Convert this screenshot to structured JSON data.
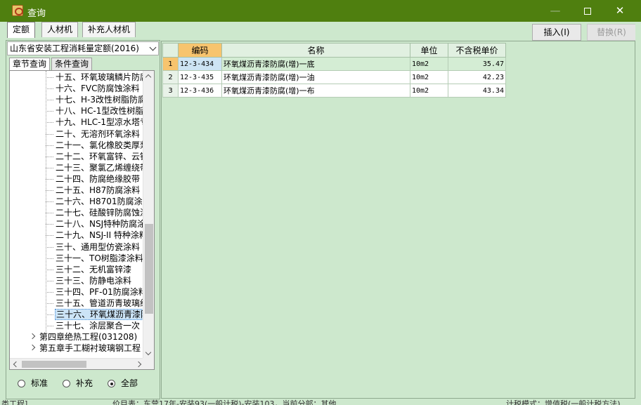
{
  "window": {
    "title": "查询"
  },
  "tabs": [
    "定额",
    "人材机",
    "补充人材机"
  ],
  "buttons": {
    "insert": "插入(I)",
    "replace": "替换(R)"
  },
  "left": {
    "dropdown": "山东省安装工程消耗量定额(2016)",
    "subtabs": [
      "章节查询",
      "条件查询"
    ],
    "tree": [
      {
        "label": "十五、环氧玻璃鳞片防腐",
        "type": "leaf"
      },
      {
        "label": "十六、FVC防腐蚀涂料",
        "type": "leaf"
      },
      {
        "label": "十七、H-3改性树脂防腐",
        "type": "leaf"
      },
      {
        "label": "十八、HC-1型改性树脂防",
        "type": "leaf"
      },
      {
        "label": "十九、HLC-1型凉水塔专",
        "type": "leaf"
      },
      {
        "label": "二十、无溶剂环氧涂料",
        "type": "leaf"
      },
      {
        "label": "二十一、氯化橡胶类厚浆",
        "type": "leaf"
      },
      {
        "label": "二十二、环氧富锌、云铁",
        "type": "leaf"
      },
      {
        "label": "二十三、聚氯乙烯缠绕带",
        "type": "leaf"
      },
      {
        "label": "二十四、防腐绝缘胶带",
        "type": "leaf"
      },
      {
        "label": "二十五、H87防腐涂料",
        "type": "leaf"
      },
      {
        "label": "二十六、H8701防腐涂料",
        "type": "leaf"
      },
      {
        "label": "二十七、硅酸锌防腐蚀涂",
        "type": "leaf"
      },
      {
        "label": "二十八、NSJ特种防腐涂",
        "type": "leaf"
      },
      {
        "label": "二十九、NSJ-II 特种涂料",
        "type": "leaf"
      },
      {
        "label": "三十、通用型仿瓷涂料",
        "type": "leaf"
      },
      {
        "label": "三十一、TO树脂漆涂料",
        "type": "leaf"
      },
      {
        "label": "三十二、无机富锌漆",
        "type": "leaf"
      },
      {
        "label": "三十三、防静电涂料",
        "type": "leaf"
      },
      {
        "label": "三十四、PF-01防腐涂料",
        "type": "leaf"
      },
      {
        "label": "三十五、管道沥青玻璃纤",
        "type": "leaf"
      },
      {
        "label": "三十六、环氧煤沥青漆防",
        "type": "selected"
      },
      {
        "label": "三十七、涂层聚合一次",
        "type": "leaf"
      },
      {
        "label": "第四章绝热工程(031208)",
        "type": "chapter"
      },
      {
        "label": "第五章手工糊衬玻璃钢工程",
        "type": "chapter"
      }
    ],
    "radios": [
      {
        "label": "标准",
        "checked": false
      },
      {
        "label": "补充",
        "checked": false
      },
      {
        "label": "全部",
        "checked": true
      }
    ]
  },
  "table": {
    "headers": [
      "编码",
      "名称",
      "单位",
      "不含税单价"
    ],
    "rows": [
      {
        "n": "1",
        "code": "12-3-434",
        "name": "环氧煤沥青漆防腐(增)一底",
        "unit": "10m2",
        "price": "35.47"
      },
      {
        "n": "2",
        "code": "12-3-435",
        "name": "环氧煤沥青漆防腐(增)一油",
        "unit": "10m2",
        "price": "42.23"
      },
      {
        "n": "3",
        "code": "12-3-436",
        "name": "环氧煤沥青漆防腐(增)一布",
        "unit": "10m2",
        "price": "43.34"
      }
    ]
  },
  "status": {
    "left": "类工程]",
    "middle": "价目表：东营17年-安装93(一般计税)-安装103，当前分部：其他",
    "right": "计税模式：增值税(一般计税方法)"
  },
  "colors": {
    "titlebar": "#4f7f0f",
    "panel": "#cde8cd",
    "sorted_header": "#f7c46e"
  }
}
